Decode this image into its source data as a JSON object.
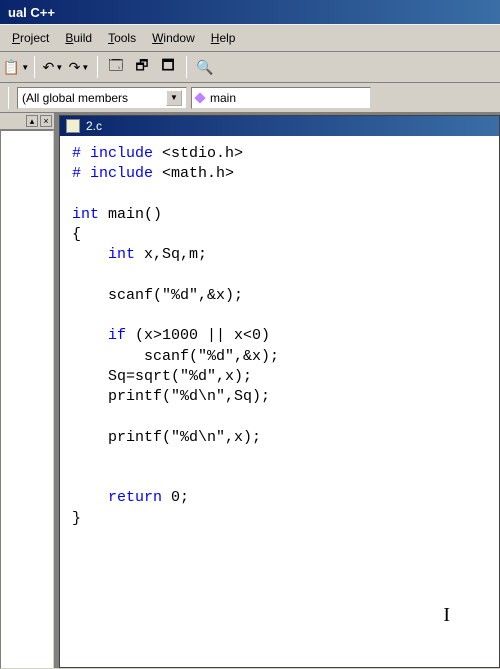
{
  "title": "ual C++",
  "menu": {
    "project": "Project",
    "build": "Build",
    "tools": "Tools",
    "window": "Window",
    "help": "Help"
  },
  "combos": {
    "globals": "(All global members",
    "main": "main"
  },
  "filename": "2.c",
  "code": {
    "l1a": "# include ",
    "l1b": "<stdio.h>",
    "l2a": "# include ",
    "l2b": "<math.h>",
    "l3a": "int",
    "l3b": " main()",
    "l4": "{",
    "l5a": "    int",
    "l5b": " x,Sq,m;",
    "l6": "    scanf(\"%d\",&x);",
    "l7a": "    if",
    "l7b": " (x>1000 || x<0)",
    "l8": "        scanf(\"%d\",&x);",
    "l9": "    Sq=sqrt(\"%d\",x);",
    "l10": "    printf(\"%d\\n\",Sq);",
    "l11": "    printf(\"%d\\n\",x);",
    "l12a": "    return",
    "l12b": " 0;",
    "l13": "}"
  }
}
